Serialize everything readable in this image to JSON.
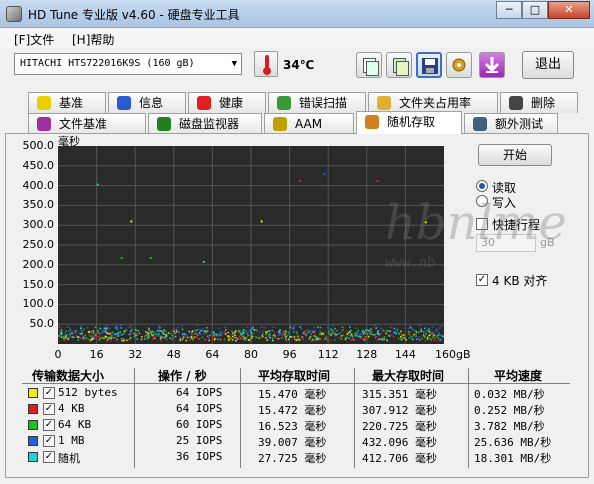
{
  "window": {
    "title": "HD Tune 专业版 v4.60 - 硬盘专业工具",
    "minimize": "─",
    "maximize": "□",
    "close": "✕"
  },
  "menu": {
    "file": "[F]文件",
    "help": "[H]帮助"
  },
  "toolbar": {
    "drive": "HITACHI HTS722016K9S  (160 gB)",
    "temperature": "34℃",
    "exit_label": "退出"
  },
  "tabs_row1": [
    {
      "label": "基准",
      "icon": "lightbulb-icon"
    },
    {
      "label": "信息",
      "icon": "info-icon"
    },
    {
      "label": "健康",
      "icon": "health-cross-icon"
    },
    {
      "label": "错误扫描",
      "icon": "magnifier-icon"
    },
    {
      "label": "文件夹占用率",
      "icon": "folder-icon"
    },
    {
      "label": "删除",
      "icon": "trash-icon"
    }
  ],
  "tabs_row2": [
    {
      "label": "文件基准",
      "icon": "file-bulb-icon"
    },
    {
      "label": "磁盘监视器",
      "icon": "monitor-chart-icon"
    },
    {
      "label": "AAM",
      "icon": "speaker-icon"
    },
    {
      "label": "随机存取",
      "icon": "random-access-icon",
      "active": true
    },
    {
      "label": "额外测试",
      "icon": "extra-test-icon"
    }
  ],
  "controls": {
    "start_label": "开始",
    "read_label": "读取",
    "write_label": "写入",
    "quick_label": "快捷行程",
    "gb_value": "30",
    "gb_unit": "gB",
    "align_label": "4 KB 对齐",
    "mode_selected": "读取"
  },
  "watermark": {
    "text": "hbnlme",
    "sub": "www.nb"
  },
  "chart_data": {
    "type": "scatter",
    "title": "",
    "ylabel": "毫秒",
    "xlabel": "gB",
    "ylim": [
      0,
      500
    ],
    "xlim": [
      0,
      160
    ],
    "y_ticks": [
      "500.0",
      "450.0",
      "400.0",
      "350.0",
      "300.0",
      "250.0",
      "200.0",
      "150.0",
      "100.0",
      "50.0"
    ],
    "x_ticks": [
      "0",
      "16",
      "32",
      "48",
      "64",
      "80",
      "96",
      "112",
      "128",
      "144",
      "160gB"
    ],
    "grid": true,
    "background": "#2a2a2a",
    "series": [
      {
        "name": "512 bytes",
        "color": "#e8e800",
        "band": [
          10,
          35
        ]
      },
      {
        "name": "4 KB",
        "color": "#e02020",
        "band": [
          10,
          35
        ]
      },
      {
        "name": "64 KB",
        "color": "#20c020",
        "band": [
          12,
          38
        ]
      },
      {
        "name": "1 MB",
        "color": "#2060e0",
        "band": [
          20,
          50
        ]
      },
      {
        "name": "随机",
        "color": "#20d0d0",
        "band": [
          12,
          45
        ]
      }
    ],
    "outliers": [
      {
        "x": 30,
        "y": 312,
        "series": "512 bytes"
      },
      {
        "x": 84,
        "y": 312,
        "series": "512 bytes"
      },
      {
        "x": 152,
        "y": 310,
        "series": "512 bytes"
      },
      {
        "x": 100,
        "y": 414,
        "series": "4 KB"
      },
      {
        "x": 132,
        "y": 414,
        "series": "4 KB"
      },
      {
        "x": 38,
        "y": 220,
        "series": "64 KB"
      },
      {
        "x": 26,
        "y": 220,
        "series": "64 KB"
      },
      {
        "x": 110,
        "y": 432,
        "series": "1 MB"
      },
      {
        "x": 16,
        "y": 405,
        "series": "随机"
      },
      {
        "x": 60,
        "y": 210,
        "series": "随机"
      }
    ]
  },
  "table": {
    "headers": [
      "传输数据大小",
      "操作 / 秒",
      "平均存取时间",
      "最大存取时间",
      "平均速度"
    ],
    "rows": [
      {
        "color": "#f0f000",
        "size": "512 bytes",
        "ops": "64 IOPS",
        "avg": "15.470 毫秒",
        "max": "315.351 毫秒",
        "speed": "0.032 MB/秒"
      },
      {
        "color": "#e02020",
        "size": "4 KB",
        "ops": "64 IOPS",
        "avg": "15.472 毫秒",
        "max": "307.912 毫秒",
        "speed": "0.252 MB/秒"
      },
      {
        "color": "#20c020",
        "size": "64 KB",
        "ops": "60 IOPS",
        "avg": "16.523 毫秒",
        "max": "220.725 毫秒",
        "speed": "3.782 MB/秒"
      },
      {
        "color": "#2060e0",
        "size": "1 MB",
        "ops": "25 IOPS",
        "avg": "39.007 毫秒",
        "max": "432.096 毫秒",
        "speed": "25.636 MB/秒"
      },
      {
        "color": "#20d0d0",
        "size": "随机",
        "ops": "36 IOPS",
        "avg": "27.725 毫秒",
        "max": "412.706 毫秒",
        "speed": "18.301 MB/秒"
      }
    ]
  }
}
